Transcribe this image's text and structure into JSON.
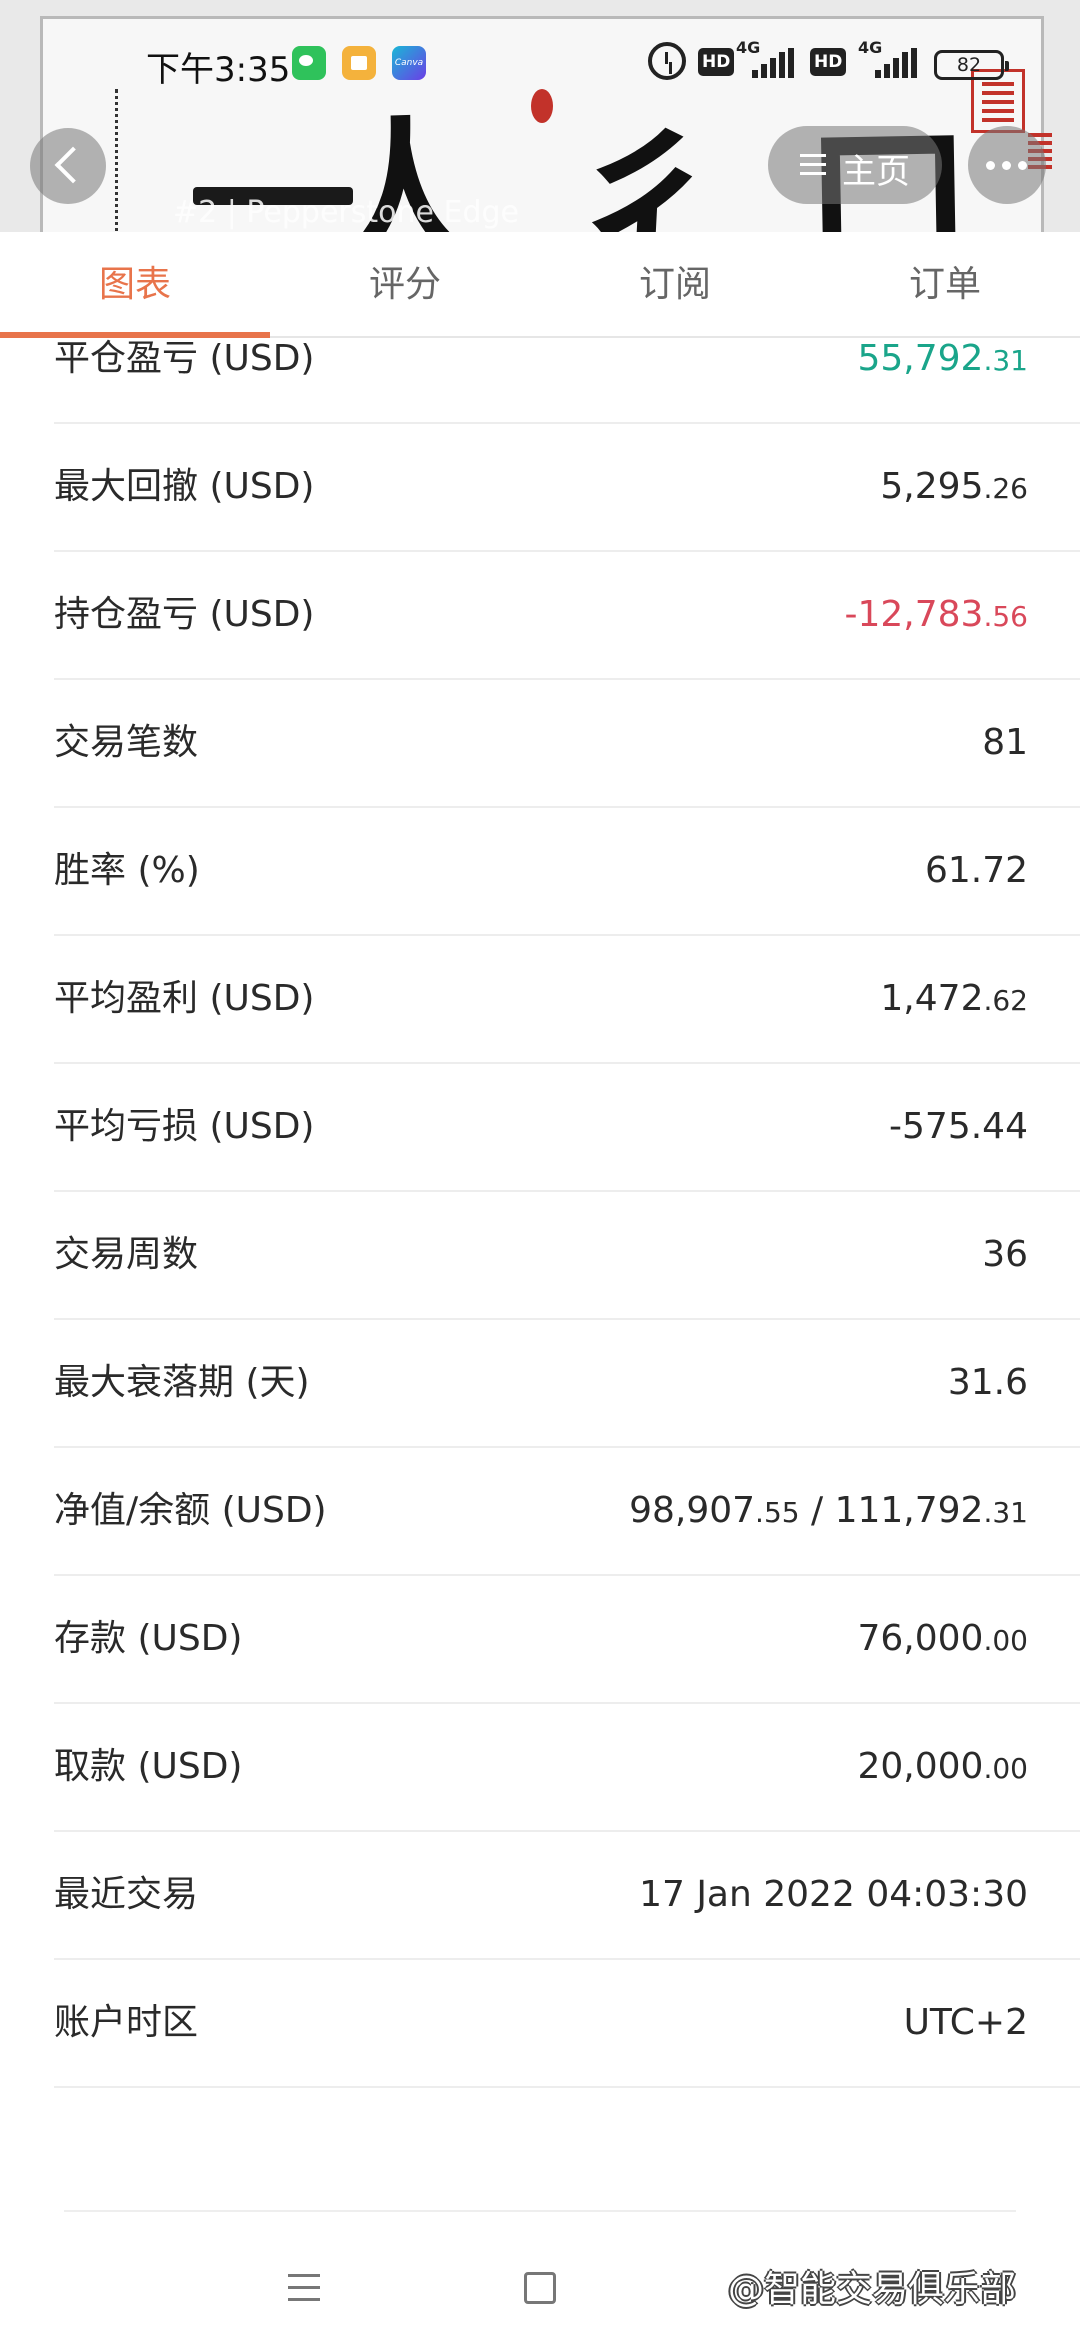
{
  "status_bar": {
    "time": "下午3:35",
    "icons": [
      "wechat-icon",
      "notes-icon",
      "canva-icon",
      "alarm-icon",
      "hd-icon",
      "signal-icon",
      "battery-icon"
    ],
    "hd_label": "HD",
    "network_label": "4G",
    "canva_label": "Canva",
    "battery": "82"
  },
  "header": {
    "banner_ghost_text": "#2 | Pepperstone Edge",
    "home_label": "主页"
  },
  "tabs": [
    {
      "label": "图表",
      "active": true
    },
    {
      "label": "评分",
      "active": false
    },
    {
      "label": "订阅",
      "active": false
    },
    {
      "label": "订单",
      "active": false
    }
  ],
  "stats": [
    {
      "label": "平仓盈亏 (USD)",
      "value_int": "55,792",
      "value_dec": ".31",
      "tone": "pos"
    },
    {
      "label": "最大回撤 (USD)",
      "value_int": "5,295",
      "value_dec": ".26",
      "tone": "normal"
    },
    {
      "label": "持仓盈亏 (USD)",
      "value_int": "-12,783",
      "value_dec": ".56",
      "tone": "neg"
    },
    {
      "label": "交易笔数",
      "value_int": "81",
      "value_dec": "",
      "tone": "normal"
    },
    {
      "label": "胜率 (%)",
      "value_int": "61.72",
      "value_dec": "",
      "tone": "normal"
    },
    {
      "label": "平均盈利 (USD)",
      "value_int": "1,472",
      "value_dec": ".62",
      "tone": "normal"
    },
    {
      "label": "平均亏损 (USD)",
      "value_int": "-575.44",
      "value_dec": "",
      "tone": "normal"
    },
    {
      "label": "交易周数",
      "value_int": "36",
      "value_dec": "",
      "tone": "normal"
    },
    {
      "label": "最大衰落期 (天)",
      "value_int": "31.6",
      "value_dec": "",
      "tone": "normal"
    },
    {
      "label": "净值/余额 (USD)",
      "value_int": "98,907",
      "value_dec": ".55",
      "value_sep": " / ",
      "value_int2": "111,792",
      "value_dec2": ".31",
      "tone": "normal"
    },
    {
      "label": "存款 (USD)",
      "value_int": "76,000",
      "value_dec": ".00",
      "tone": "normal"
    },
    {
      "label": "取款 (USD)",
      "value_int": "20,000",
      "value_dec": ".00",
      "tone": "normal"
    },
    {
      "label": "最近交易",
      "value_int": "17 Jan 2022 04:03:30",
      "value_dec": "",
      "tone": "normal"
    },
    {
      "label": "账户时区",
      "value_int": "UTC+2",
      "value_dec": "",
      "tone": "normal"
    }
  ],
  "footer": {
    "watermark": "@智能交易俱乐部",
    "nav_icons": [
      "menu-icon",
      "home-square-icon"
    ]
  },
  "colors": {
    "accent": "#e8744b",
    "positive": "#1aa58a",
    "negative": "#d9485a"
  }
}
